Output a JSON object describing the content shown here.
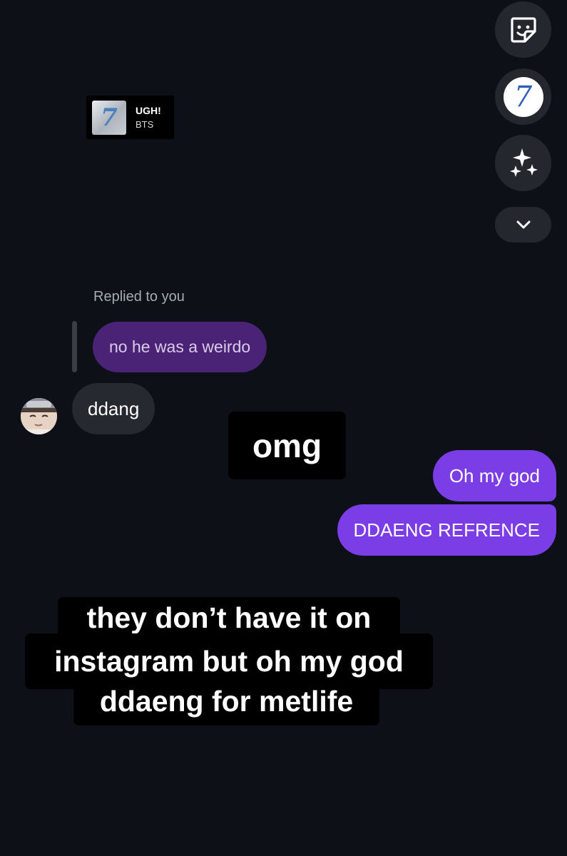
{
  "tools": {
    "sticker_icon": "sticker-icon",
    "album_badge": "7",
    "effects_icon": "sparkles-icon",
    "collapse_icon": "chevron-down-icon"
  },
  "music_sticker": {
    "title": "UGH!",
    "artist": "BTS",
    "art_glyph": "7"
  },
  "conversation": {
    "replied_label": "Replied to you",
    "quoted_message": "no he was a weirdo",
    "received_message": "ddang",
    "sent_messages": [
      "Oh my god",
      "DDAENG REFRENCE"
    ]
  },
  "captions": {
    "omg": "omg",
    "block_lines": [
      "they don’t have it on",
      "instagram but oh my god",
      "ddaeng for metlife"
    ]
  },
  "colors": {
    "background": "#0d1016",
    "sent_bubble": "#7a3de6",
    "quoted_bubble": "#4b2376",
    "received_bubble": "#26292f"
  }
}
